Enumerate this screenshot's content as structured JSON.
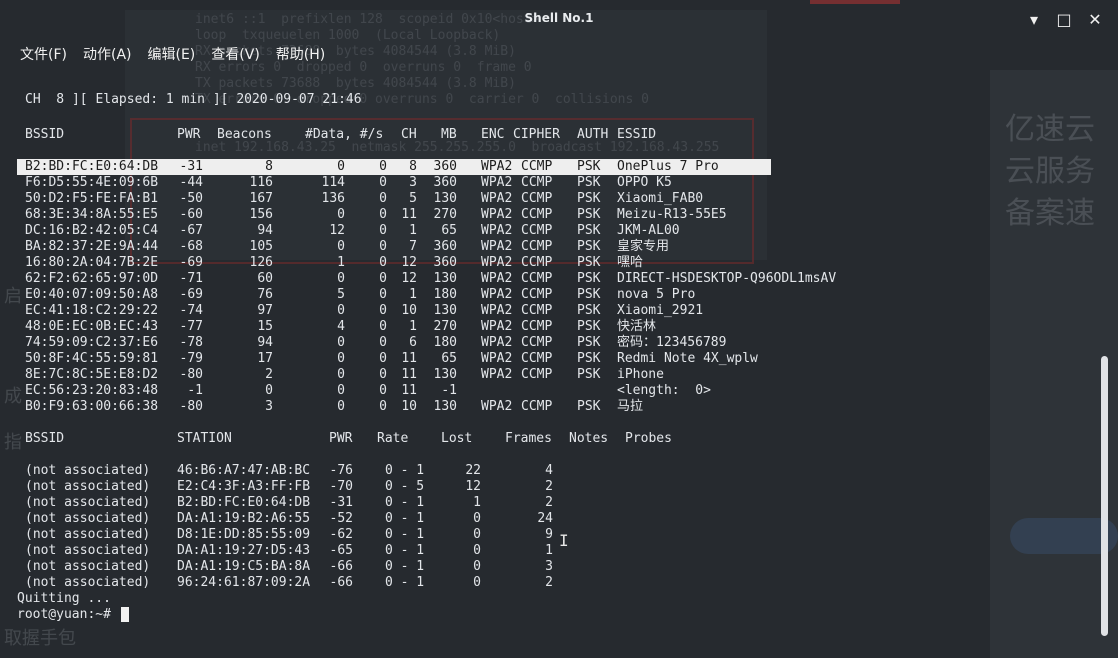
{
  "window": {
    "title": "Shell No.1"
  },
  "window_controls": {
    "minimize": "▾",
    "maximize": "□",
    "close": "✕"
  },
  "menu": {
    "items": [
      "文件(F)",
      "动作(A)",
      "编辑(E)",
      "查看(V)",
      "帮助(H)"
    ]
  },
  "status_line": "CH  8 ][ Elapsed: 1 min ][ 2020-09-07 21:46",
  "ap_table": {
    "headers": [
      "BSSID",
      "PWR",
      "Beacons",
      "#Data, #/s",
      "CH",
      "MB",
      "ENC",
      "CIPHER",
      "AUTH",
      "ESSID"
    ],
    "rows": [
      [
        "B2:BD:FC:E0:64:DB",
        "-31",
        "8",
        "0",
        "0",
        "8",
        "360",
        "WPA2",
        "CCMP",
        "PSK",
        "OnePlus 7 Pro"
      ],
      [
        "F6:D5:55:4E:09:6B",
        "-44",
        "116",
        "114",
        "0",
        "3",
        "360",
        "WPA2",
        "CCMP",
        "PSK",
        "OPPO K5"
      ],
      [
        "50:D2:F5:FE:FA:B1",
        "-50",
        "167",
        "136",
        "0",
        "5",
        "130",
        "WPA2",
        "CCMP",
        "PSK",
        "Xiaomi_FAB0"
      ],
      [
        "68:3E:34:8A:55:E5",
        "-60",
        "156",
        "0",
        "0",
        "11",
        "270",
        "WPA2",
        "CCMP",
        "PSK",
        "Meizu-R13-55E5"
      ],
      [
        "DC:16:B2:42:05:C4",
        "-67",
        "94",
        "12",
        "0",
        "1",
        "65",
        "WPA2",
        "CCMP",
        "PSK",
        "JKM-AL00"
      ],
      [
        "BA:82:37:2E:9A:44",
        "-68",
        "105",
        "0",
        "0",
        "7",
        "360",
        "WPA2",
        "CCMP",
        "PSK",
        "皇家专用"
      ],
      [
        "16:80:2A:04:7B:2E",
        "-69",
        "126",
        "1",
        "0",
        "12",
        "360",
        "WPA2",
        "CCMP",
        "PSK",
        "嘿哈"
      ],
      [
        "62:F2:62:65:97:0D",
        "-71",
        "60",
        "0",
        "0",
        "12",
        "130",
        "WPA2",
        "CCMP",
        "PSK",
        "DIRECT-HSDESKTOP-Q96ODL1msAV"
      ],
      [
        "E0:40:07:09:50:A8",
        "-69",
        "76",
        "5",
        "0",
        "1",
        "180",
        "WPA2",
        "CCMP",
        "PSK",
        "nova 5 Pro"
      ],
      [
        "EC:41:18:C2:29:22",
        "-74",
        "97",
        "0",
        "0",
        "10",
        "130",
        "WPA2",
        "CCMP",
        "PSK",
        "Xiaomi_2921"
      ],
      [
        "48:0E:EC:0B:EC:43",
        "-77",
        "15",
        "4",
        "0",
        "1",
        "270",
        "WPA2",
        "CCMP",
        "PSK",
        "快活林"
      ],
      [
        "74:59:09:C2:37:E6",
        "-78",
        "94",
        "0",
        "0",
        "6",
        "180",
        "WPA2",
        "CCMP",
        "PSK",
        "密码：123456789"
      ],
      [
        "50:8F:4C:55:59:81",
        "-79",
        "17",
        "0",
        "0",
        "11",
        "65",
        "WPA2",
        "CCMP",
        "PSK",
        "Redmi Note 4X_wplw"
      ],
      [
        "8E:7C:8C:5E:E8:D2",
        "-80",
        "2",
        "0",
        "0",
        "11",
        "130",
        "WPA2",
        "CCMP",
        "PSK",
        "iPhone"
      ],
      [
        "EC:56:23:20:83:48",
        "-1",
        "0",
        "0",
        "0",
        "11",
        "-1",
        "",
        "",
        "",
        "<length:  0>"
      ],
      [
        "B0:F9:63:00:66:38",
        "-80",
        "3",
        "0",
        "0",
        "10",
        "130",
        "WPA2",
        "CCMP",
        "PSK",
        "马拉"
      ]
    ]
  },
  "station_table": {
    "headers": [
      "BSSID",
      "STATION",
      "PWR",
      "Rate",
      "Lost",
      "Frames",
      "Notes",
      "Probes"
    ],
    "rows": [
      [
        "(not associated)",
        "46:B6:A7:47:AB:BC",
        "-76",
        "0 - 1",
        "22",
        "4"
      ],
      [
        "(not associated)",
        "E2:C4:3F:A3:FF:FB",
        "-70",
        "0 - 5",
        "12",
        "2"
      ],
      [
        "(not associated)",
        "B2:BD:FC:E0:64:DB",
        "-31",
        "0 - 1",
        "1",
        "2"
      ],
      [
        "(not associated)",
        "DA:A1:19:B2:A6:55",
        "-52",
        "0 - 1",
        "0",
        "24"
      ],
      [
        "(not associated)",
        "D8:1E:DD:85:55:09",
        "-62",
        "0 - 1",
        "0",
        "9"
      ],
      [
        "(not associated)",
        "DA:A1:19:27:D5:43",
        "-65",
        "0 - 1",
        "0",
        "1"
      ],
      [
        "(not associated)",
        "DA:A1:19:C5:BA:8A",
        "-66",
        "0 - 1",
        "0",
        "3"
      ],
      [
        "(not associated)",
        "96:24:61:87:09:2A",
        "-66",
        "0 - 1",
        "0",
        "2"
      ]
    ]
  },
  "footer": {
    "quitting": "Quitting ...",
    "prompt": "root@yuan:~# "
  },
  "background_ghost": {
    "lines": [
      "inet6 ::1  prefixlen 128  scopeid 0x10<host>",
      "loop  txqueuelen 1000  (Local Loopback)",
      "RX packets 73688  bytes 4084544 (3.8 MiB)",
      "RX errors 0  dropped 0  overruns 0  frame 0",
      "TX packets 73688  bytes 4084544 (3.8 MiB)",
      "TX errors 0  dropped 0 overruns 0  carrier 0  collisions 0",
      "inet 192.168.43.25  netmask 255.255.255.0  broadcast 192.168.43.255"
    ],
    "right_title_1": "亿速云",
    "right_title_2": "云服务",
    "right_title_3": "备案速",
    "left_frag_1": "启",
    "left_frag_2": "成",
    "left_frag_3": "指",
    "left_frag_4": "取握手包"
  }
}
